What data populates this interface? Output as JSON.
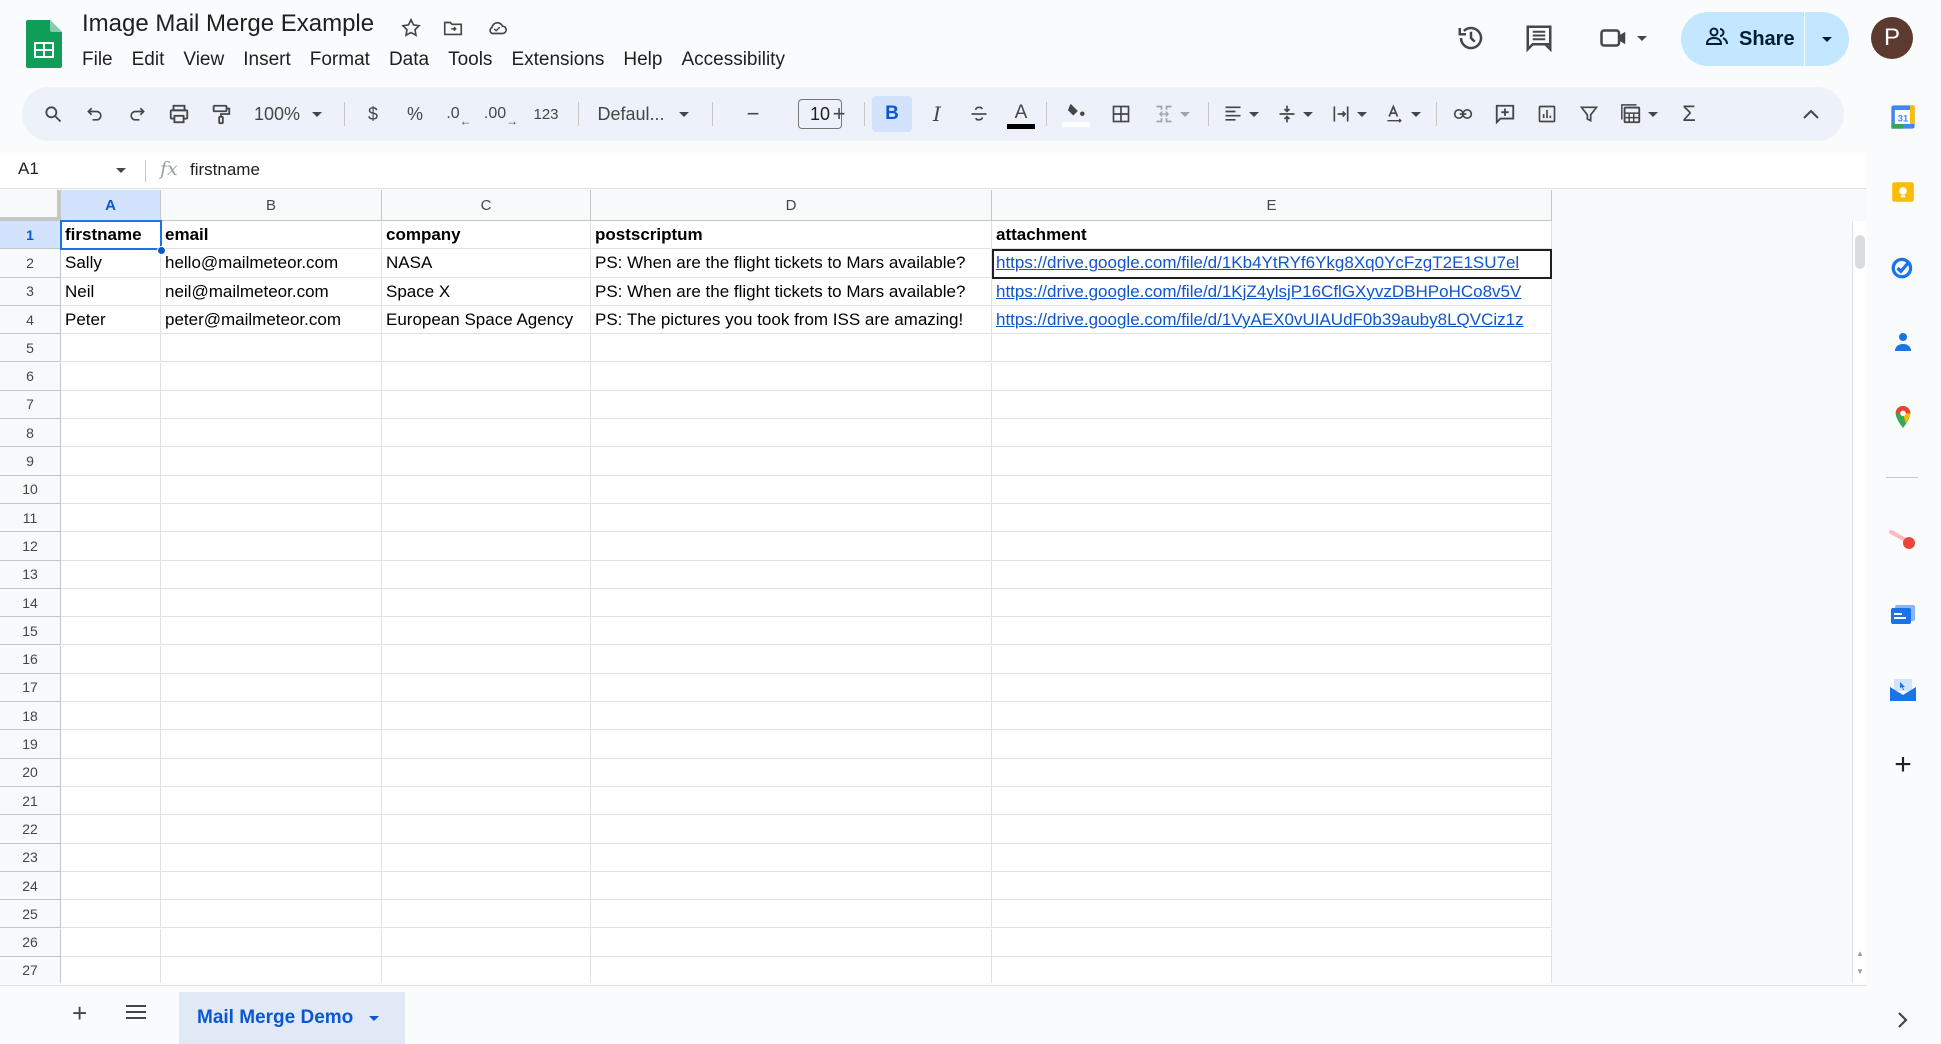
{
  "app": {
    "title": "Image Mail Merge Example",
    "menu": [
      "File",
      "Edit",
      "View",
      "Insert",
      "Format",
      "Data",
      "Tools",
      "Extensions",
      "Help",
      "Accessibility"
    ],
    "share_label": "Share",
    "avatar_initial": "P",
    "brand_color": "#0f9d58",
    "accent_color": "#0b57d0"
  },
  "toolbar": {
    "zoom": "100%",
    "currency": "$",
    "percent": "%",
    "decrease_decimal": ".0",
    "increase_decimal": ".00",
    "number_format": "123",
    "font": "Defaul...",
    "font_size": "10",
    "bold": "B",
    "italic": "I",
    "text_color_label": "A",
    "sum": "Σ"
  },
  "formula_bar": {
    "name_box": "A1",
    "fx": "fx",
    "value": "firstname"
  },
  "sheet": {
    "columns": [
      "A",
      "B",
      "C",
      "D",
      "E"
    ],
    "row_numbers": [
      "1",
      "2",
      "3",
      "4",
      "5",
      "6",
      "7",
      "8",
      "9",
      "10",
      "11",
      "12",
      "13",
      "14",
      "15",
      "16",
      "17",
      "18",
      "19",
      "20",
      "21",
      "22",
      "23",
      "24",
      "25",
      "26",
      "27"
    ],
    "selected_cell": "A1",
    "rows": [
      [
        "firstname",
        "email",
        "company",
        "postscriptum",
        "attachment"
      ],
      [
        "Sally",
        "hello@mailmeteor.com",
        "NASA",
        "PS: When are the flight tickets to Mars available?",
        "https://drive.google.com/file/d/1Kb4YtRYf6Ykg8Xq0YcFzgT2E1SU7el"
      ],
      [
        "Neil",
        "neil@mailmeteor.com",
        "Space X",
        "PS: When are the flight tickets to Mars available?",
        "https://drive.google.com/file/d/1KjZ4ylsjP16CflGXyvzDBHPoHCo8v5V"
      ],
      [
        "Peter",
        "peter@mailmeteor.com",
        "European Space Agency",
        "PS: The pictures you took from ISS are amazing!",
        "https://drive.google.com/file/d/1VyAEX0vUIAUdF0b39auby8LQVCiz1z"
      ]
    ]
  },
  "tabs": {
    "active": "Mail Merge Demo"
  }
}
